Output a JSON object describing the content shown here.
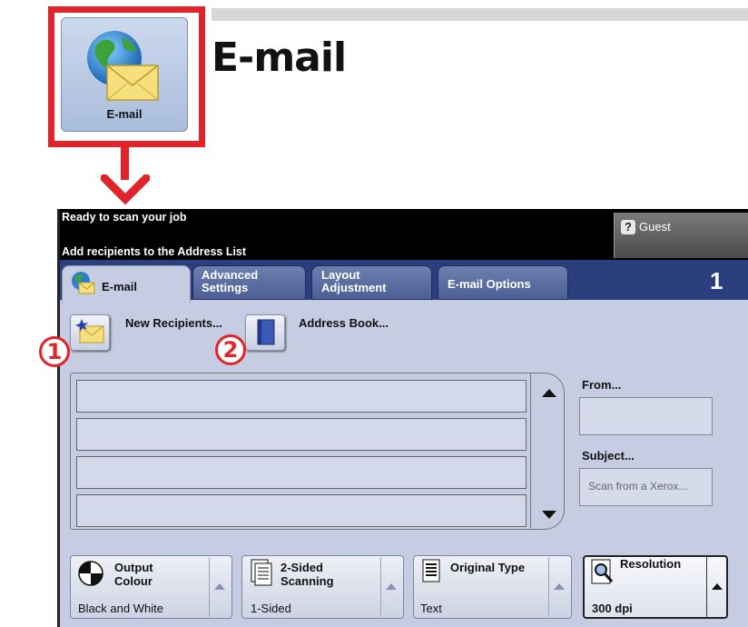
{
  "header": {
    "title": "E-mail",
    "home_tile_label": "E-mail"
  },
  "status": {
    "line1": "Ready to scan your job",
    "line2": "Add recipients to the Address List",
    "user": "Guest"
  },
  "tabs": [
    {
      "label": "E-mail",
      "active": true
    },
    {
      "label": "Advanced\nSettings",
      "active": false
    },
    {
      "label": "Layout\nAdjustment",
      "active": false
    },
    {
      "label": "E-mail Options",
      "active": false
    }
  ],
  "job_count": "1",
  "buttons": {
    "new_recipients": "New Recipients...",
    "address_book": "Address Book..."
  },
  "markers": [
    "1",
    "2"
  ],
  "recipients": [
    "",
    "",
    "",
    ""
  ],
  "side": {
    "from_label": "From...",
    "from_value": "",
    "subject_label": "Subject...",
    "subject_value": "Scan from a Xerox..."
  },
  "features": [
    {
      "title": "Output\nColour",
      "value": "Black and White"
    },
    {
      "title": "2-Sided\nScanning",
      "value": "1-Sided"
    },
    {
      "title": "Original Type",
      "value": "Text"
    },
    {
      "title": "Resolution",
      "value": "300 dpi"
    }
  ],
  "colors": {
    "highlight_red": "#e0242a",
    "tab_blue": "#2b3f7e",
    "panel_bg": "#c6cde2"
  }
}
